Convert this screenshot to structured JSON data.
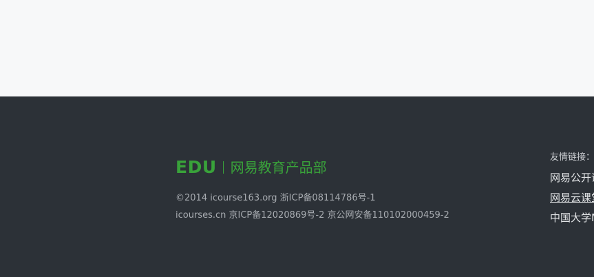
{
  "footer": {
    "logo": {
      "edu": "EDU",
      "department": "网易教育产品部"
    },
    "copyright_line_1": "©2014 icourse163.org 浙ICP备08114786号-1",
    "copyright_line_2": "icourses.cn 京ICP备12020869号-2 京公网安备110102000459-2",
    "friend_links": {
      "label": "友情链接：",
      "items": [
        "网易公开课",
        "网易云课堂",
        "中国大学MOOC"
      ]
    }
  },
  "colors": {
    "top_background": "#f7f8f9",
    "footer_background": "#2c3137",
    "brand_green": "#39a23a",
    "muted_text": "#a8acb1"
  }
}
